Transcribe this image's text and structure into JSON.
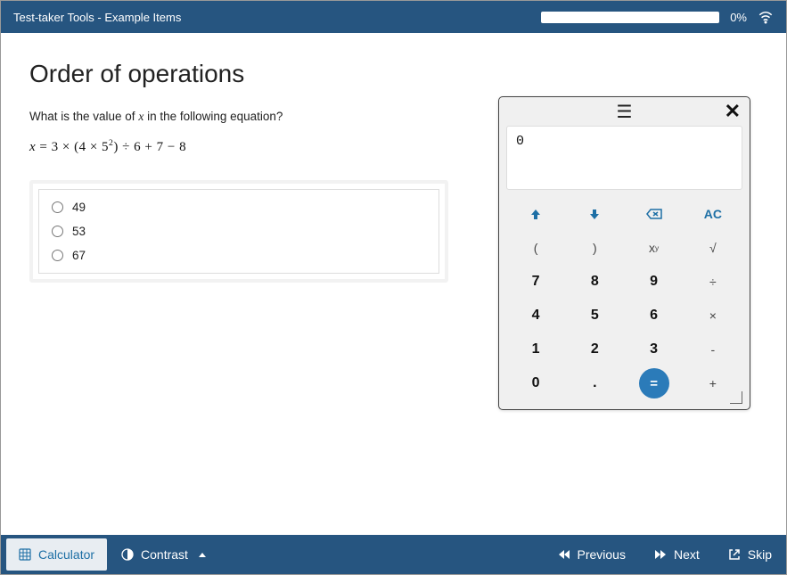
{
  "header": {
    "title": "Test-taker Tools - Example Items",
    "progress_pct": "0%"
  },
  "question": {
    "title": "Order of operations",
    "prompt_pre": "What is the value of ",
    "prompt_var": "x",
    "prompt_post": " in the following equation?",
    "equation_html": "x = 3 × (4 × 5²) ÷ 6 + 7 − 8",
    "choices": [
      "49",
      "53",
      "67"
    ]
  },
  "calculator": {
    "display": "0",
    "keys": [
      {
        "label": "↑",
        "kind": "accent",
        "name": "calc-up"
      },
      {
        "label": "↓",
        "kind": "accent",
        "name": "calc-down"
      },
      {
        "label": "⌫",
        "kind": "accent",
        "name": "calc-backspace"
      },
      {
        "label": "AC",
        "kind": "accent",
        "name": "calc-ac"
      },
      {
        "label": "(",
        "kind": "fn",
        "name": "calc-lparen"
      },
      {
        "label": ")",
        "kind": "fn",
        "name": "calc-rparen"
      },
      {
        "label": "xʸ",
        "kind": "fn",
        "name": "calc-pow"
      },
      {
        "label": "√",
        "kind": "fn",
        "name": "calc-sqrt"
      },
      {
        "label": "7",
        "kind": "bold",
        "name": "calc-7"
      },
      {
        "label": "8",
        "kind": "bold",
        "name": "calc-8"
      },
      {
        "label": "9",
        "kind": "bold",
        "name": "calc-9"
      },
      {
        "label": "÷",
        "kind": "fn",
        "name": "calc-div"
      },
      {
        "label": "4",
        "kind": "bold",
        "name": "calc-4"
      },
      {
        "label": "5",
        "kind": "bold",
        "name": "calc-5"
      },
      {
        "label": "6",
        "kind": "bold",
        "name": "calc-6"
      },
      {
        "label": "×",
        "kind": "fn",
        "name": "calc-mul"
      },
      {
        "label": "1",
        "kind": "bold",
        "name": "calc-1"
      },
      {
        "label": "2",
        "kind": "bold",
        "name": "calc-2"
      },
      {
        "label": "3",
        "kind": "bold",
        "name": "calc-3"
      },
      {
        "label": "-",
        "kind": "fn",
        "name": "calc-sub"
      },
      {
        "label": "0",
        "kind": "bold",
        "name": "calc-0"
      },
      {
        "label": ".",
        "kind": "bold",
        "name": "calc-dot"
      },
      {
        "label": "=",
        "kind": "eq",
        "name": "calc-eq"
      },
      {
        "label": "+",
        "kind": "fn",
        "name": "calc-add"
      }
    ]
  },
  "footer": {
    "calculator": "Calculator",
    "contrast": "Contrast",
    "previous": "Previous",
    "next": "Next",
    "skip": "Skip"
  }
}
